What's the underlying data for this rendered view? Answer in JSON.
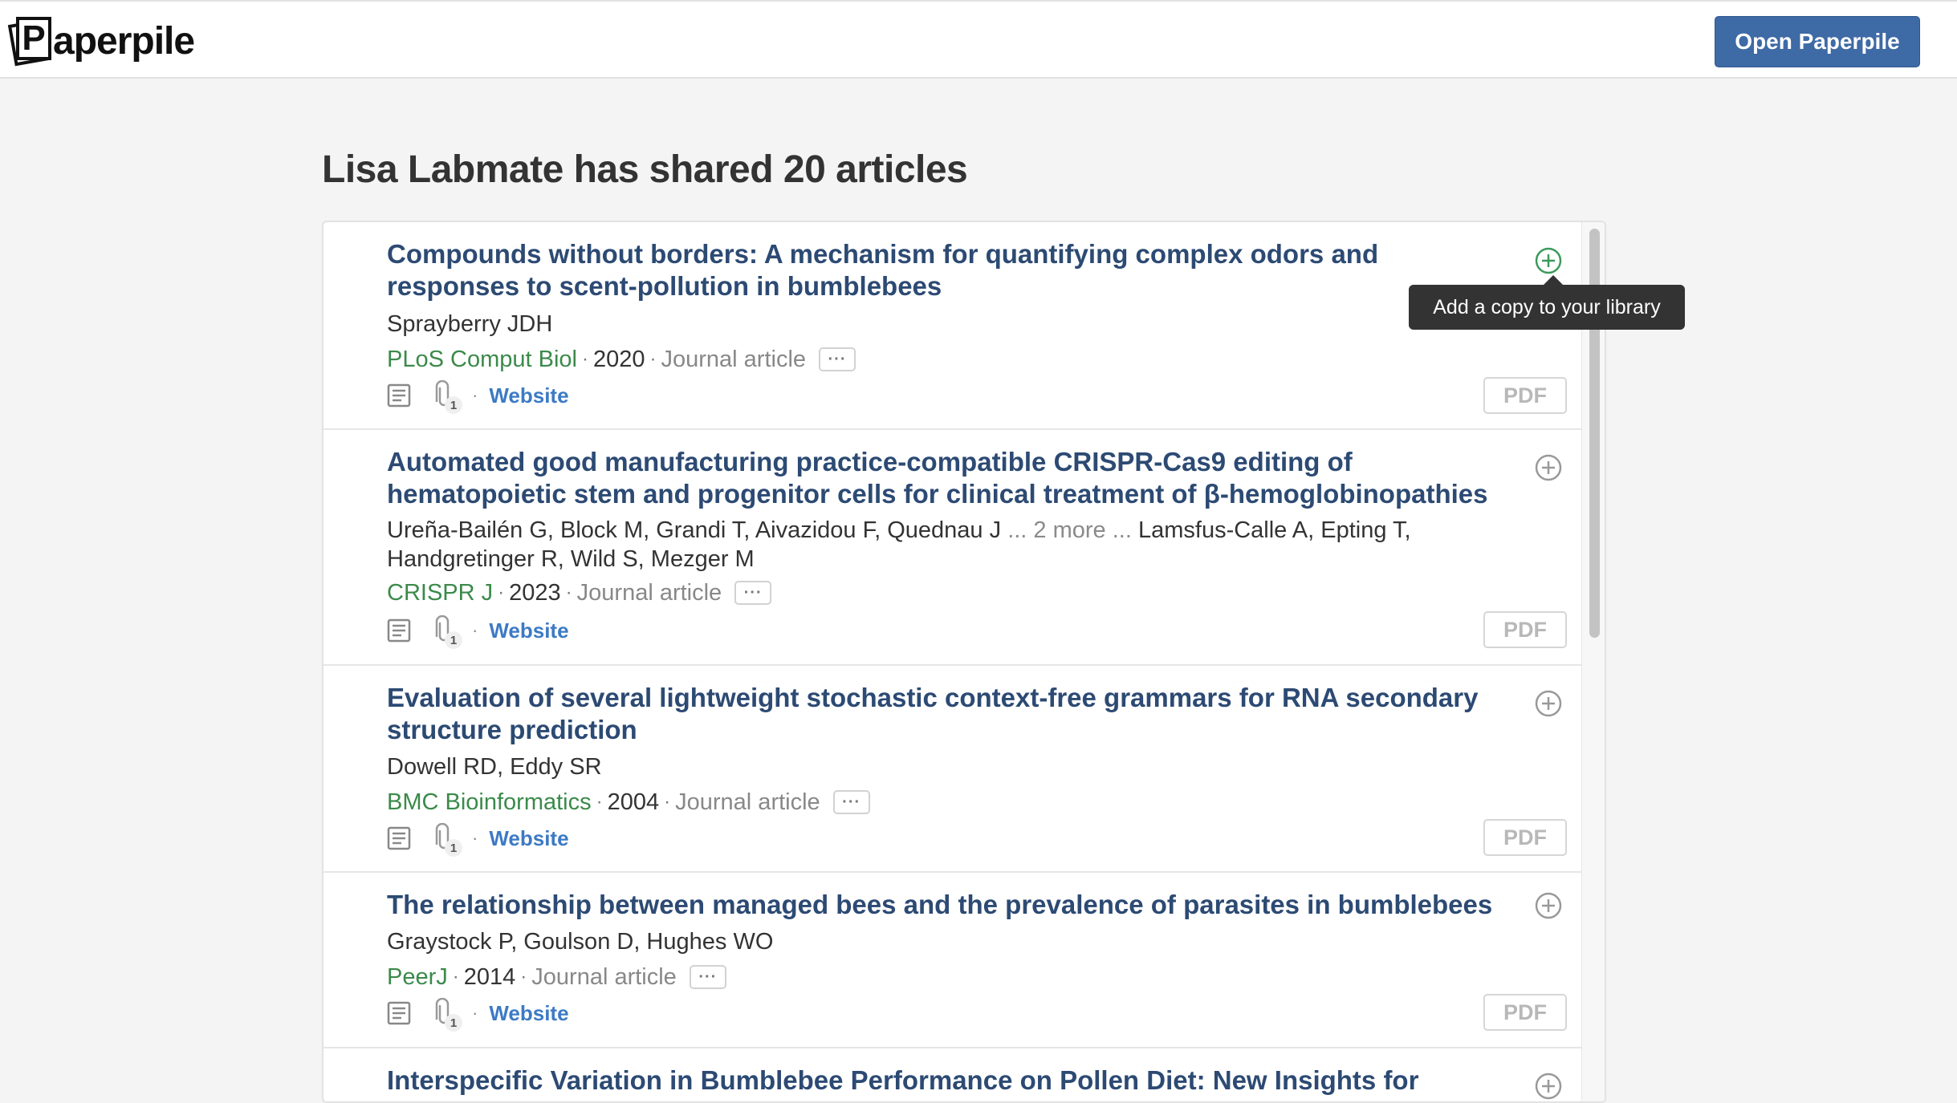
{
  "brand": {
    "logo_letter": "P",
    "logo_text": "aperpile"
  },
  "header": {
    "open_button": "Open Paperpile"
  },
  "page_title": "Lisa Labmate has shared 20 articles",
  "tooltip": "Add a copy to your library",
  "colors": {
    "accent": "#3e6aa6",
    "title": "#2c4a73",
    "journal": "#3b8a4a",
    "link": "#3d7ac4",
    "add_active": "#3b9a5a"
  },
  "articles": [
    {
      "title": "Compounds without borders: A mechanism for quantifying complex odors and responses to scent-pollution in bumblebees",
      "authors": "Sprayberry JDH",
      "journal": "PLoS Comput Biol",
      "year": "2020",
      "type": "Journal article",
      "more": "···",
      "attachments": "1",
      "sep": "·",
      "website": "Website",
      "pdf": "PDF"
    },
    {
      "title": "Automated good manufacturing practice-compatible CRISPR-Cas9 editing of hematopoietic stem and progenitor cells for clinical treatment of β-hemoglobinopathies",
      "authors_pre": "Ureña-Bailén G, Block M, Grandi T, Aivazidou F, Quednau J",
      "authors_more": "... 2 more ...",
      "authors_post": "Lamsfus-Calle A, Epting T, Handgretinger R, Wild S, Mezger M",
      "journal": "CRISPR J",
      "year": "2023",
      "type": "Journal article",
      "more": "···",
      "attachments": "1",
      "sep": "·",
      "website": "Website",
      "pdf": "PDF"
    },
    {
      "title": "Evaluation of several lightweight stochastic context-free grammars for RNA secondary structure prediction",
      "authors": "Dowell RD, Eddy SR",
      "journal": "BMC Bioinformatics",
      "year": "2004",
      "type": "Journal article",
      "more": "···",
      "attachments": "1",
      "sep": "·",
      "website": "Website",
      "pdf": "PDF"
    },
    {
      "title": "The relationship between managed bees and the prevalence of parasites in bumblebees",
      "authors": "Graystock P, Goulson D, Hughes WO",
      "journal": "PeerJ",
      "year": "2014",
      "type": "Journal article",
      "more": "···",
      "attachments": "1",
      "sep": "·",
      "website": "Website",
      "pdf": "PDF"
    },
    {
      "title": "Interspecific Variation in Bumblebee Performance on Pollen Diet: New Insights for"
    }
  ]
}
